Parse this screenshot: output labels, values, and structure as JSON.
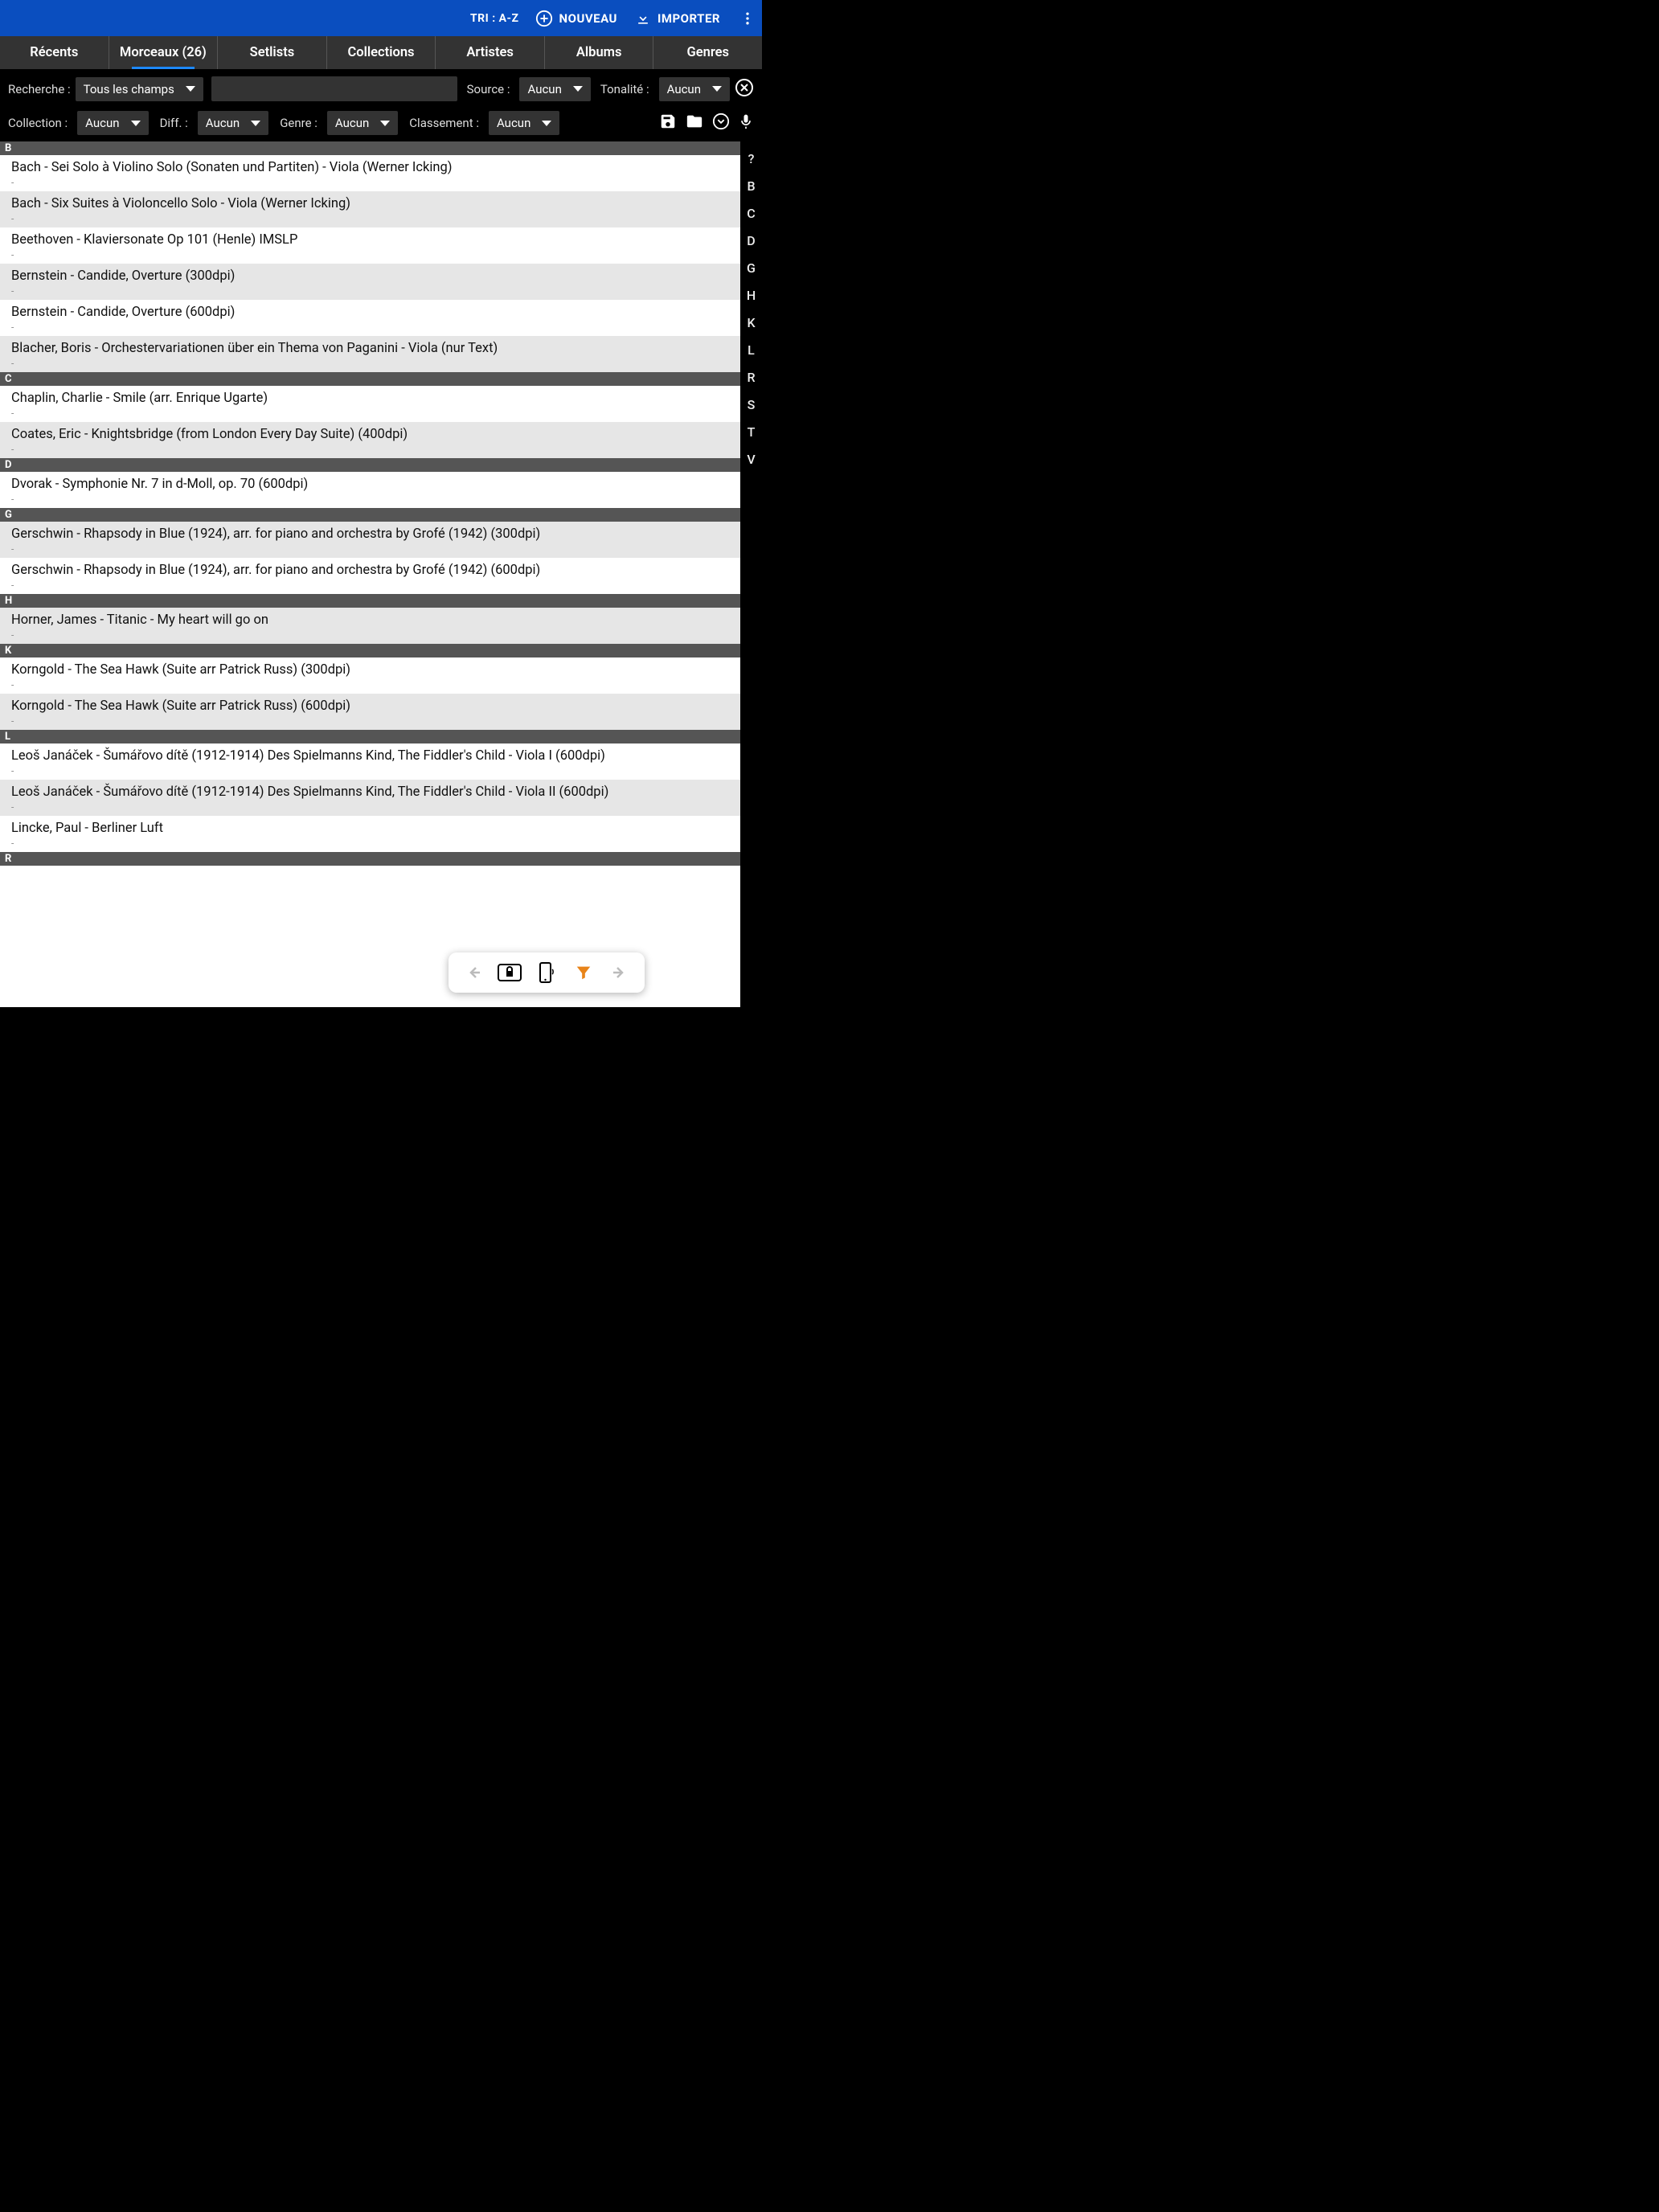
{
  "topbar": {
    "sort_label": "TRI : A-Z",
    "new_label": "NOUVEAU",
    "import_label": "IMPORTER"
  },
  "tabs": {
    "recents": "Récents",
    "songs": "Morceaux (26)",
    "setlists": "Setlists",
    "collections": "Collections",
    "artists": "Artistes",
    "albums": "Albums",
    "genres": "Genres"
  },
  "filters": {
    "search_label": "Recherche :",
    "search_field_value": "Tous les champs",
    "source_label": "Source :",
    "source_value": "Aucun",
    "key_label": "Tonalité :",
    "key_value": "Aucun",
    "collection_label": "Collection :",
    "collection_value": "Aucun",
    "diff_label": "Diff. :",
    "diff_value": "Aucun",
    "genre_label": "Genre :",
    "genre_value": "Aucun",
    "rating_label": "Classement :",
    "rating_value": "Aucun"
  },
  "alpha_index": [
    "?",
    "B",
    "C",
    "D",
    "G",
    "H",
    "K",
    "L",
    "R",
    "S",
    "T",
    "V"
  ],
  "sections": [
    {
      "letter": "B",
      "items": [
        {
          "title": "Bach - Sei Solo à Violino Solo (Sonaten und Partiten) - Viola (Werner Icking)",
          "sub": "-"
        },
        {
          "title": "Bach - Six Suites à Violoncello Solo - Viola (Werner Icking)",
          "sub": "-"
        },
        {
          "title": "Beethoven - Klaviersonate Op 101 (Henle) IMSLP",
          "sub": "-"
        },
        {
          "title": "Bernstein - Candide, Overture (300dpi)",
          "sub": "-"
        },
        {
          "title": "Bernstein - Candide, Overture (600dpi)",
          "sub": "-"
        },
        {
          "title": "Blacher, Boris - Orchestervariationen über ein Thema von Paganini - Viola (nur Text)",
          "sub": "-"
        }
      ]
    },
    {
      "letter": "C",
      "items": [
        {
          "title": "Chaplin, Charlie - Smile (arr. Enrique Ugarte)",
          "sub": "-"
        },
        {
          "title": "Coates, Eric - Knightsbridge (from London Every Day Suite) (400dpi)",
          "sub": "-"
        }
      ]
    },
    {
      "letter": "D",
      "items": [
        {
          "title": "Dvorak - Symphonie Nr. 7 in d-Moll, op. 70 (600dpi)",
          "sub": "-"
        }
      ]
    },
    {
      "letter": "G",
      "items": [
        {
          "title": "Gerschwin - Rhapsody in Blue (1924), arr. for piano and orchestra by Grofé (1942) (300dpi)",
          "sub": "-"
        },
        {
          "title": "Gerschwin - Rhapsody in Blue (1924), arr. for piano and orchestra by Grofé (1942) (600dpi)",
          "sub": "-"
        }
      ]
    },
    {
      "letter": "H",
      "items": [
        {
          "title": "Horner, James - Titanic - My heart will go on",
          "sub": "-"
        }
      ]
    },
    {
      "letter": "K",
      "items": [
        {
          "title": "Korngold - The Sea Hawk (Suite arr Patrick Russ) (300dpi)",
          "sub": "-"
        },
        {
          "title": "Korngold - The Sea Hawk (Suite arr Patrick Russ) (600dpi)",
          "sub": "-"
        }
      ]
    },
    {
      "letter": "L",
      "items": [
        {
          "title": "Leoš Janáček - Šumářovo dítě (1912-1914) Des Spielmanns Kind, The Fiddler's Child - Viola I (600dpi)",
          "sub": "-"
        },
        {
          "title": "Leoš Janáček - Šumářovo dítě (1912-1914) Des Spielmanns Kind, The Fiddler's Child - Viola II (600dpi)",
          "sub": "-"
        },
        {
          "title": "Lincke, Paul - Berliner Luft",
          "sub": "-"
        }
      ]
    },
    {
      "letter": "R",
      "items": []
    }
  ]
}
